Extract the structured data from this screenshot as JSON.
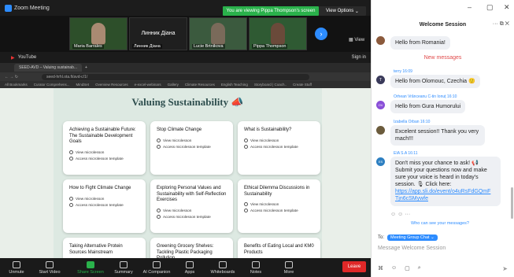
{
  "zoom": {
    "app_title": "Zoom Meeting",
    "viewing_banner": "You are viewing Pippa Thompson's screen",
    "view_options": "View Options",
    "gallery_view_label": "View",
    "participants": [
      {
        "name": "Maria Barrales"
      },
      {
        "name": "Линник Діана",
        "display_label": "Линник Діана"
      },
      {
        "name": "Lucie Brtnikova"
      },
      {
        "name": "Pippa Thompson"
      }
    ]
  },
  "shared_screen": {
    "youtube_label": "YouTube",
    "signin": "Sign in",
    "tab_title": "SEED-AVD – Valuing sustainab...",
    "url": "seed-hrhl.ota.fi/avd-c/1/",
    "bookmarks": [
      "All Bookmarks",
      "Curator Comprehens...",
      "MindSet",
      "Overview Resources",
      "e-excel-webinars",
      "Gallery",
      "Climate Resources",
      "English Teaching",
      "Storyboard | Coach..",
      "Create Stuff"
    ],
    "page_title": "Valuing Sustainability",
    "cards": [
      {
        "title": "Achieving a Sustainable Future: The Sustainable Development Goals",
        "view": "View microlesson",
        "access": "Access microlesson template"
      },
      {
        "title": "Stop Climate Change",
        "view": "View microlesson",
        "access": "Access microlesson template"
      },
      {
        "title": "What is Sustainability?",
        "view": "View microlesson",
        "access": "Access microlesson template"
      },
      {
        "title": "How to Fight Climate Change",
        "view": "View microlesson",
        "access": "Access microlesson template"
      },
      {
        "title": "Exploring Personal Values and Sustainability with Self-Reflection Exercises",
        "view": "View microlesson",
        "access": "Access microlesson template"
      },
      {
        "title": "Ethical Dilemma Discussions in Sustainability",
        "view": "View microlesson",
        "access": "Access microlesson template"
      },
      {
        "title": "Taking Alternative Protein Sources Mainstream",
        "view": "",
        "access": ""
      },
      {
        "title": "Greening Grocery Shelves: Tackling Plastic Packaging Pollution",
        "view": "",
        "access": ""
      },
      {
        "title": "Benefits of Eating Local and KM0 Products",
        "view": "",
        "access": ""
      }
    ]
  },
  "toolbar": {
    "items": [
      "Unmute",
      "Start Video",
      "Share Screen",
      "Summary",
      "AI Companion",
      "Apps",
      "Whiteboards",
      "Notes",
      "More"
    ],
    "leave": "Leave"
  },
  "chat": {
    "title": "Welcome Session",
    "new_messages": "New messages",
    "messages": [
      {
        "sender": "",
        "text": "Hello from Romania!",
        "avatar_color": "#8b5a3c"
      },
      {
        "sender": "terry 16:09",
        "text": "Hello from Olomouc, Czechia 🙂",
        "avatar_color": "#3a3a5a",
        "initial": "T"
      },
      {
        "sender": "Orhean Vrănceanu C-tin Ionuț 16:10",
        "text": "Hello from Gura Humorului",
        "avatar_color": "#8a4fd8",
        "initial": "OV"
      },
      {
        "sender": "Izabella Orban 16:10",
        "text": "Excelent session!! Thank you very mach!!!",
        "avatar_color": "#6b5b3c"
      },
      {
        "sender": "EIA S.A 16:11",
        "text": "Don't miss your chance to ask! 📢 Submit your questions now and make sure your voice is heard in today's session. 🎙 Click here: ",
        "link": "https://app.sli.do/event/o4uRsFdGQmF Tjn6cSMywfe",
        "avatar_color": "#2d7fc1",
        "initial": "ES"
      }
    ],
    "who_can_see": "Who can see your messages?",
    "to_label": "To:",
    "to_target": "Meeting Group Chat",
    "input_placeholder": "Message Welcome Session"
  }
}
